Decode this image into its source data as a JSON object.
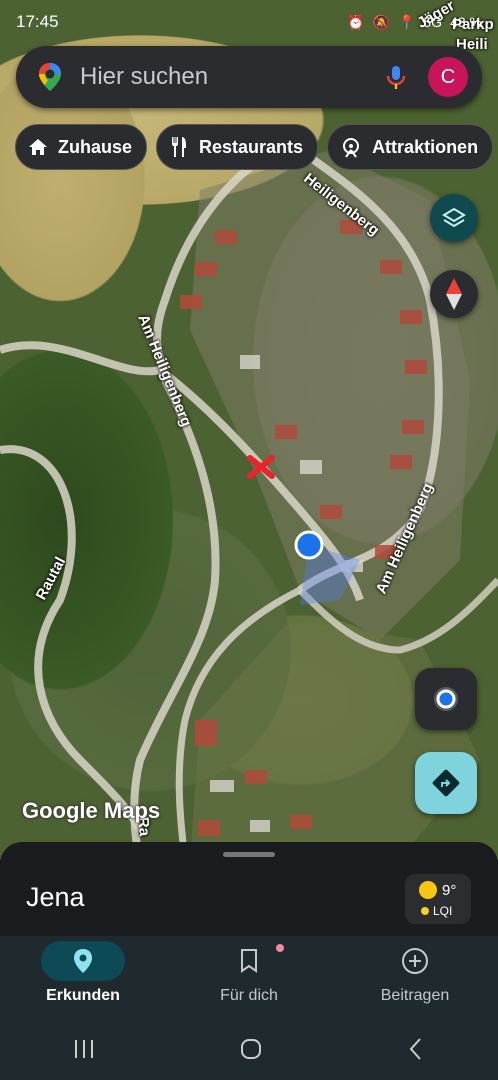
{
  "status": {
    "time": "17:45",
    "battery": "43 %"
  },
  "search": {
    "placeholder": "Hier suchen",
    "avatar_letter": "C"
  },
  "chips": [
    {
      "label": "Zuhause",
      "icon": "home-icon"
    },
    {
      "label": "Restaurants",
      "icon": "restaurant-icon"
    },
    {
      "label": "Attraktionen",
      "icon": "attraction-icon"
    }
  ],
  "map": {
    "labels": {
      "heiligenberg_top": "Heiligenberg",
      "am_heiligenberg_left": "Am Heiligenberg",
      "am_heiligenberg_right": "Am Heiligenberg",
      "rautal": "Rautal",
      "jaeger": "Jäger",
      "parkp": "Parkp",
      "heili": "Heili",
      "ra": "Ra"
    },
    "attribution": "Google Maps"
  },
  "sheet": {
    "title": "Jena",
    "temperature": "9°",
    "air_quality": "LQI"
  },
  "nav": [
    {
      "label": "Erkunden",
      "icon": "explore-pin-icon",
      "active": true
    },
    {
      "label": "Für dich",
      "icon": "bookmark-icon",
      "active": false
    },
    {
      "label": "Beitragen",
      "icon": "add-circle-icon",
      "active": false
    }
  ],
  "colors": {
    "accent": "#7fd3dd",
    "location_dot": "#1a73e8",
    "avatar": "#c8145a"
  }
}
